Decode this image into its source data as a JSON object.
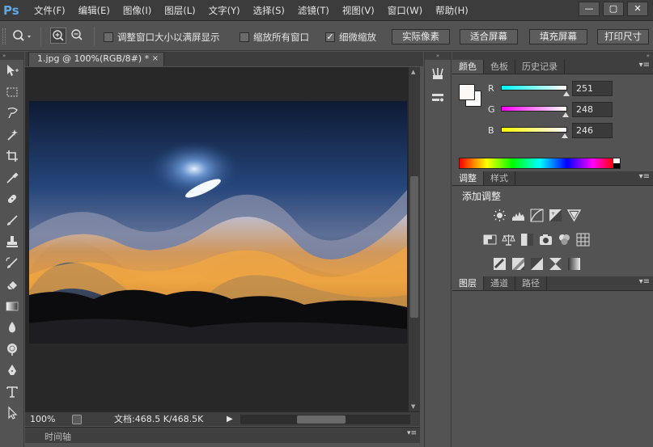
{
  "app": {
    "logo": "Ps",
    "menu": [
      "文件(F)",
      "编辑(E)",
      "图像(I)",
      "图层(L)",
      "文字(Y)",
      "选择(S)",
      "滤镜(T)",
      "视图(V)",
      "窗口(W)",
      "帮助(H)"
    ],
    "window_buttons": {
      "minimize": "—",
      "restore": "▢",
      "close": "✕"
    }
  },
  "options": {
    "resize_windows_label": "调整窗口大小以满屏显示",
    "resize_windows_checked": false,
    "zoom_all_label": "缩放所有窗口",
    "zoom_all_checked": false,
    "scrubby_zoom_label": "细微缩放",
    "scrubby_zoom_checked": true,
    "scrubby_check_mark": "✓",
    "btn_actual_pixels": "实际像素",
    "btn_fit_screen": "适合屏幕",
    "btn_fill_screen": "填充屏幕",
    "btn_print_size": "打印尺寸"
  },
  "document": {
    "tab_title": "1.jpg @ 100%(RGB/8#) *",
    "tab_close": "×",
    "zoom": "100%",
    "doc_info": "文档:468.5 K/468.5K",
    "status_arrow": "▶"
  },
  "timeline": {
    "label": "时间轴",
    "menu": "▾≡"
  },
  "color_panel": {
    "tabs": [
      "颜色",
      "色板",
      "历史记录"
    ],
    "active_tab": 0,
    "r_label": "R",
    "r_value": "251",
    "r_fraction": 0.984,
    "g_label": "G",
    "g_value": "248",
    "g_fraction": 0.973,
    "b_label": "B",
    "b_value": "246",
    "b_fraction": 0.965,
    "fg_color": "#fbf8f6"
  },
  "adjust_panel": {
    "tabs": [
      "调整",
      "样式"
    ],
    "active_tab": 0,
    "title": "添加调整"
  },
  "layers_panel": {
    "tabs": [
      "图层",
      "通道",
      "路径"
    ],
    "active_tab": 0
  },
  "panel_menu_glyph": "▾≡",
  "dock_collapse_glyph": "»",
  "tools": [
    "move-tool",
    "marquee-tool",
    "lasso-tool",
    "quick-select-tool",
    "crop-tool",
    "eyedropper-tool",
    "healing-brush-tool",
    "brush-tool",
    "clone-stamp-tool",
    "history-brush-tool",
    "eraser-tool",
    "gradient-tool",
    "blur-tool",
    "dodge-tool",
    "pen-tool",
    "type-tool",
    "path-select-tool"
  ]
}
